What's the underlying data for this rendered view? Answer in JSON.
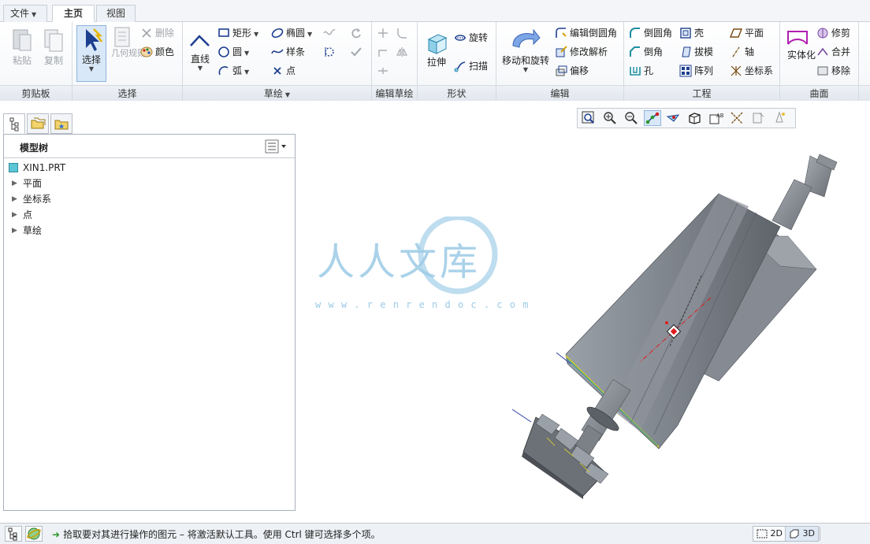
{
  "menu_tabs": {
    "file": "文件",
    "home": "主页",
    "view": "视图"
  },
  "ribbon": {
    "clipboard": {
      "title": "剪贴板",
      "paste": "粘贴",
      "copy": "复制"
    },
    "select": {
      "title": "选择",
      "select": "选择",
      "geometry_rules": "几何规则",
      "delete": "删除",
      "color": "颜色"
    },
    "sketch": {
      "title": "草绘",
      "line": "直线",
      "rectangle": "矩形",
      "circle": "圆",
      "arc": "弧",
      "ellipse": "椭圆",
      "spline": "样条",
      "point": "点"
    },
    "edit_sketch": {
      "title": "编辑草绘"
    },
    "shapes": {
      "title": "形状",
      "extrude": "拉伸",
      "revolve": "旋转",
      "sweep": "扫描"
    },
    "edit": {
      "title": "编辑",
      "move_rotate": "移动和旋转",
      "edit_round": "编辑倒圆角",
      "modify_analysis": "修改解析",
      "offset": "偏移"
    },
    "engineering": {
      "title": "工程",
      "round": "倒圆角",
      "chamfer": "倒角",
      "hole": "孔",
      "shell": "壳",
      "draft": "拔模",
      "pattern": "阵列",
      "plane": "平面",
      "axis": "轴",
      "csys": "坐标系"
    },
    "surfaces": {
      "title": "曲面",
      "solidify": "实体化",
      "trim": "修剪",
      "merge": "合并",
      "remove": "移除"
    }
  },
  "model_tree": {
    "title": "模型树",
    "root": "XIN1.PRT",
    "items": [
      "平面",
      "坐标系",
      "点",
      "草绘"
    ]
  },
  "watermark": {
    "brand": "人人文库",
    "url": "w w w . r e n r e n d o c . c o m"
  },
  "status": {
    "message": "拾取要对其进行操作的图元 – 将激活默认工具。使用 Ctrl 键可选择多个项。",
    "mode_2d": "2D",
    "mode_3d": "3D"
  },
  "colors": {
    "accent": "#2f6fb3",
    "model_gray": "#8c9099",
    "selection_red": "#e01b1b"
  }
}
